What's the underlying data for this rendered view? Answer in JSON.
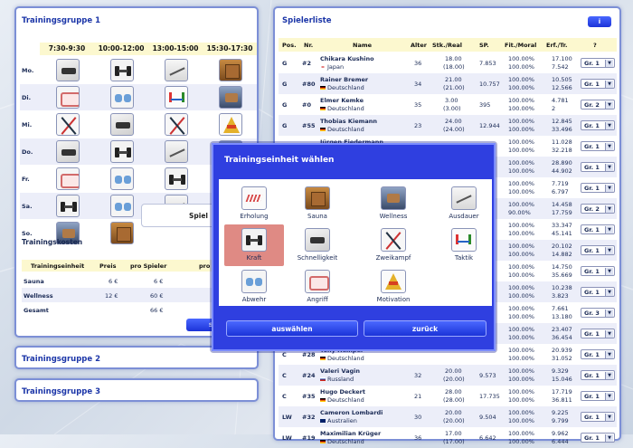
{
  "group1": {
    "title": "Trainingsgruppe 1",
    "time_slots": [
      "7:30-9:30",
      "10:00-12:00",
      "13:00-15:00",
      "15:30-17:30"
    ],
    "days": [
      {
        "label": "Mo.",
        "slots": [
          "eq",
          "dumb",
          "skate",
          "sauna"
        ]
      },
      {
        "label": "Di.",
        "slots": [
          "pads",
          "shield",
          "tactic",
          "wellness"
        ]
      },
      {
        "label": "Mi.",
        "slots": [
          "sticks",
          "eq",
          "sticks",
          "pyramid"
        ]
      },
      {
        "label": "Do.",
        "slots": [
          "eq",
          "dumb",
          "skate",
          "wellness"
        ]
      },
      {
        "label": "Fr.",
        "slots": [
          "pads",
          "shield",
          "dumb",
          "chair"
        ]
      },
      {
        "label": "Sa.",
        "slots": [
          "dumb",
          "shield",
          "skate",
          "chair"
        ]
      },
      {
        "label": "So.",
        "slots": [
          "wellness",
          "sauna",
          "spiel",
          "spiel"
        ]
      }
    ],
    "spiel_label": "Spiel",
    "costs_title": "Trainingskosten",
    "costs_headers": [
      "Trainingseinheit",
      "Preis",
      "pro Spieler",
      "pro Sp"
    ],
    "costs_rows": [
      {
        "name": "Sauna",
        "price": "6 €",
        "per_player": "6 €"
      },
      {
        "name": "Wellness",
        "price": "12 €",
        "per_player": "60 €"
      },
      {
        "name": "Gesamt",
        "price": "",
        "per_player": "66 €"
      }
    ],
    "save_label": "speic"
  },
  "group2": {
    "title": "Trainingsgruppe 2"
  },
  "group3": {
    "title": "Trainingsgruppe 3"
  },
  "players": {
    "title": "Spielerliste",
    "info_label": "i",
    "headers": [
      "Pos.",
      "Nr.",
      "Name",
      "Alter",
      "Stk./Real",
      "SP.",
      "Fit./Moral",
      "Erf./Tr.",
      "?"
    ],
    "rows": [
      {
        "pos": "G",
        "nr": "#2",
        "name": "Chikara Kushino",
        "country": "Japan",
        "flag": "jp",
        "age": "36",
        "stk": "18.00",
        "real": "(18.00)",
        "sp": "7.853",
        "fit": "100.00%",
        "moral": "100.00%",
        "erf": "17.100",
        "tr": "7.542",
        "gr": "Gr. 1"
      },
      {
        "pos": "G",
        "nr": "#80",
        "name": "Rainer Bremer",
        "country": "Deutschland",
        "flag": "de",
        "age": "34",
        "stk": "21.00",
        "real": "(21.00)",
        "sp": "10.757",
        "fit": "100.00%",
        "moral": "100.00%",
        "erf": "10.505",
        "tr": "12.566",
        "gr": "Gr. 1"
      },
      {
        "pos": "G",
        "nr": "#0",
        "name": "Elmer Kemke",
        "country": "Deutschland",
        "flag": "de",
        "age": "35",
        "stk": "3.00",
        "real": "(3.00)",
        "sp": "395",
        "fit": "100.00%",
        "moral": "100.00%",
        "erf": "4.781",
        "tr": "2",
        "gr": "Gr. 2"
      },
      {
        "pos": "G",
        "nr": "#55",
        "name": "Thobias Kiemann",
        "country": "Deutschland",
        "flag": "de",
        "age": "23",
        "stk": "24.00",
        "real": "(24.00)",
        "sp": "12.944",
        "fit": "100.00%",
        "moral": "100.00%",
        "erf": "12.845",
        "tr": "33.496",
        "gr": "Gr. 1"
      },
      {
        "pos": "",
        "nr": "",
        "name": "Jürgen Fiedermann",
        "country": "",
        "flag": "",
        "age": "",
        "stk": "",
        "real": "",
        "sp": "",
        "fit": "100.00%",
        "moral": "100.00%",
        "erf": "11.028",
        "tr": "32.218",
        "gr": "Gr. 1"
      },
      {
        "pos": "",
        "nr": "",
        "name": "",
        "country": "",
        "flag": "",
        "age": "",
        "stk": "",
        "real": "",
        "sp": "",
        "fit": "100.00%",
        "moral": "100.00%",
        "erf": "28.890",
        "tr": "44.902",
        "gr": "Gr. 1"
      },
      {
        "pos": "",
        "nr": "",
        "name": "",
        "country": "",
        "flag": "",
        "age": "",
        "stk": "",
        "real": "",
        "sp": "",
        "fit": "100.00%",
        "moral": "100.00%",
        "erf": "7.719",
        "tr": "6.797",
        "gr": "Gr. 1"
      },
      {
        "pos": "",
        "nr": "",
        "name": "",
        "country": "",
        "flag": "",
        "age": "",
        "stk": "",
        "real": "",
        "sp": "",
        "fit": "100.00%",
        "moral": "90.00%",
        "erf": "14.458",
        "tr": "17.759",
        "gr": "Gr. 2"
      },
      {
        "pos": "",
        "nr": "",
        "name": "",
        "country": "",
        "flag": "",
        "age": "",
        "stk": "",
        "real": "",
        "sp": "",
        "fit": "100.00%",
        "moral": "100.00%",
        "erf": "33.347",
        "tr": "45.141",
        "gr": "Gr. 1"
      },
      {
        "pos": "",
        "nr": "",
        "name": "",
        "country": "",
        "flag": "",
        "age": "",
        "stk": "",
        "real": "",
        "sp": "",
        "fit": "100.00%",
        "moral": "100.00%",
        "erf": "20.102",
        "tr": "14.882",
        "gr": "Gr. 1"
      },
      {
        "pos": "",
        "nr": "",
        "name": "",
        "country": "",
        "flag": "",
        "age": "",
        "stk": "",
        "real": "",
        "sp": "",
        "fit": "100.00%",
        "moral": "100.00%",
        "erf": "14.750",
        "tr": "35.669",
        "gr": "Gr. 1"
      },
      {
        "pos": "",
        "nr": "",
        "name": "",
        "country": "",
        "flag": "",
        "age": "",
        "stk": "",
        "real": "",
        "sp": "",
        "fit": "100.00%",
        "moral": "100.00%",
        "erf": "10.238",
        "tr": "3.823",
        "gr": "Gr. 1"
      },
      {
        "pos": "",
        "nr": "",
        "name": "",
        "country": "",
        "flag": "",
        "age": "",
        "stk": "",
        "real": "",
        "sp": "",
        "fit": "100.00%",
        "moral": "100.00%",
        "erf": "7.661",
        "tr": "13.180",
        "gr": "Gr. 3"
      },
      {
        "pos": "",
        "nr": "",
        "name": "",
        "country": "",
        "flag": "",
        "age": "",
        "stk": "",
        "real": "",
        "sp": "",
        "fit": "100.00%",
        "moral": "100.00%",
        "erf": "23.407",
        "tr": "36.454",
        "gr": "Gr. 1"
      },
      {
        "pos": "C",
        "nr": "#28",
        "name": "Tony Hempel",
        "country": "Deutschland",
        "flag": "de",
        "age": "",
        "stk": "",
        "real": "",
        "sp": "",
        "fit": "100.00%",
        "moral": "100.00%",
        "erf": "20.939",
        "tr": "31.052",
        "gr": "Gr. 1"
      },
      {
        "pos": "C",
        "nr": "#24",
        "name": "Valeri Vagin",
        "country": "Russland",
        "flag": "ru",
        "age": "32",
        "stk": "20.00",
        "real": "(20.00)",
        "sp": "9.573",
        "fit": "100.00%",
        "moral": "100.00%",
        "erf": "9.329",
        "tr": "15.046",
        "gr": "Gr. 1"
      },
      {
        "pos": "C",
        "nr": "#35",
        "name": "Hugo Deckert",
        "country": "Deutschland",
        "flag": "de",
        "age": "21",
        "stk": "28.00",
        "real": "(28.00)",
        "sp": "17.735",
        "fit": "100.00%",
        "moral": "100.00%",
        "erf": "17.719",
        "tr": "36.811",
        "gr": "Gr. 1"
      },
      {
        "pos": "LW",
        "nr": "#32",
        "name": "Cameron Lombardi",
        "country": "Australien",
        "flag": "au",
        "age": "30",
        "stk": "20.00",
        "real": "(20.00)",
        "sp": "9.504",
        "fit": "100.00%",
        "moral": "100.00%",
        "erf": "9.225",
        "tr": "9.799",
        "gr": "Gr. 1"
      },
      {
        "pos": "LW",
        "nr": "#19",
        "name": "Maximilian Krüger",
        "country": "Deutschland",
        "flag": "de",
        "age": "36",
        "stk": "17.00",
        "real": "(17.00)",
        "sp": "6.642",
        "fit": "100.00%",
        "moral": "100.00%",
        "erf": "9.962",
        "tr": "6.444",
        "gr": "Gr. 1"
      }
    ]
  },
  "modal": {
    "title": "Trainingseinheit wählen",
    "items": [
      {
        "label": "Erholung",
        "icon": "chair"
      },
      {
        "label": "Sauna",
        "icon": "sauna"
      },
      {
        "label": "Wellness",
        "icon": "wellness"
      },
      {
        "label": "Ausdauer",
        "icon": "skate"
      },
      {
        "label": "Kraft",
        "icon": "dumb",
        "selected": true
      },
      {
        "label": "Schnelligkeit",
        "icon": "eq"
      },
      {
        "label": "Zweikampf",
        "icon": "sticks"
      },
      {
        "label": "Taktik",
        "icon": "tactic"
      },
      {
        "label": "Abwehr",
        "icon": "shield"
      },
      {
        "label": "Angriff",
        "icon": "pads"
      },
      {
        "label": "Motivation",
        "icon": "pyramid"
      }
    ],
    "select_label": "auswählen",
    "back_label": "zurück"
  },
  "colors": {
    "accent": "#1c36a8",
    "modal_bg": "#2f3fe0",
    "highlight": "#df8a84",
    "header_bg": "#fcf8cf"
  }
}
